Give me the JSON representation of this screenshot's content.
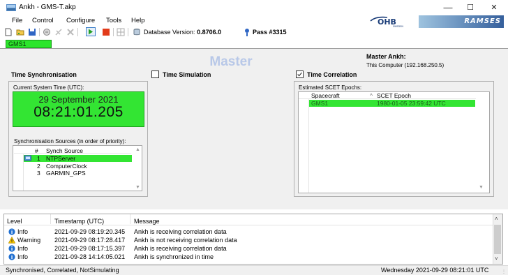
{
  "window": {
    "title": "Ankh - GMS-T.akp",
    "minimize": "—",
    "maximize": "☐",
    "close": "✕"
  },
  "menu": [
    "File",
    "Control",
    "Configure",
    "Tools",
    "Help"
  ],
  "logos": {
    "ohb": "OHB",
    "ohb_sub": "SWEDEN",
    "ramses": "RAMSES"
  },
  "toolbar": {
    "database_version_label": "Database Version:",
    "database_version_value": "0.8706.0",
    "pass_label": "Pass #3315"
  },
  "station_tab": "GMS1",
  "master": {
    "title": "Master",
    "ankh_label": "Master Ankh:",
    "ankh_value": "This Computer (192.168.250.5)"
  },
  "time_sync": {
    "title": "Time Synchronisation",
    "current_time_caption": "Current System Time (UTC):",
    "date": "29 September 2021",
    "time": "08:21:01.205",
    "sources_caption": "Synchronisation Sources (in order of priority):",
    "columns": [
      "#",
      "Synch Source"
    ],
    "sources": [
      {
        "num": "1",
        "name": "NTPServer",
        "active": true
      },
      {
        "num": "2",
        "name": "ComputerClock",
        "active": false
      },
      {
        "num": "3",
        "name": "GARMIN_GPS",
        "active": false
      }
    ]
  },
  "time_simulation": {
    "title": "Time Simulation",
    "checked": false
  },
  "time_correlation": {
    "title": "Time Correlation",
    "checked": true,
    "caption": "Estimated SCET Epochs:",
    "columns": [
      "Spacecraft",
      "SCET Epoch"
    ],
    "rows": [
      {
        "spacecraft": "GMS1",
        "epoch": "1980-01-05 23:59:42 UTC"
      }
    ]
  },
  "log": {
    "columns": [
      "Level",
      "Timestamp (UTC)",
      "Message"
    ],
    "rows": [
      {
        "level": "Info",
        "icon": "info-icon",
        "timestamp": "2021-09-29 08:19:20.345",
        "message": "Ankh is receiving correlation data"
      },
      {
        "level": "Warning",
        "icon": "warning-icon",
        "timestamp": "2021-09-29 08:17:28.417",
        "message": "Ankh is not receiving correlation data"
      },
      {
        "level": "Info",
        "icon": "info-icon",
        "timestamp": "2021-09-29 08:17:15.397",
        "message": "Ankh is receiving correlation data"
      },
      {
        "level": "Info",
        "icon": "info-icon",
        "timestamp": "2021-09-28 14:14:05.021",
        "message": "Ankh is synchronized in time"
      }
    ]
  },
  "status": {
    "left": "Synchronised, Correlated, NotSimulating",
    "right": "Wednesday 2021-09-29 08:21:01 UTC"
  },
  "colors": {
    "active_green": "#33e533",
    "info_blue": "#1f6fd1",
    "warning_yellow": "#f2c200",
    "master_title": "#b8c8e8"
  }
}
